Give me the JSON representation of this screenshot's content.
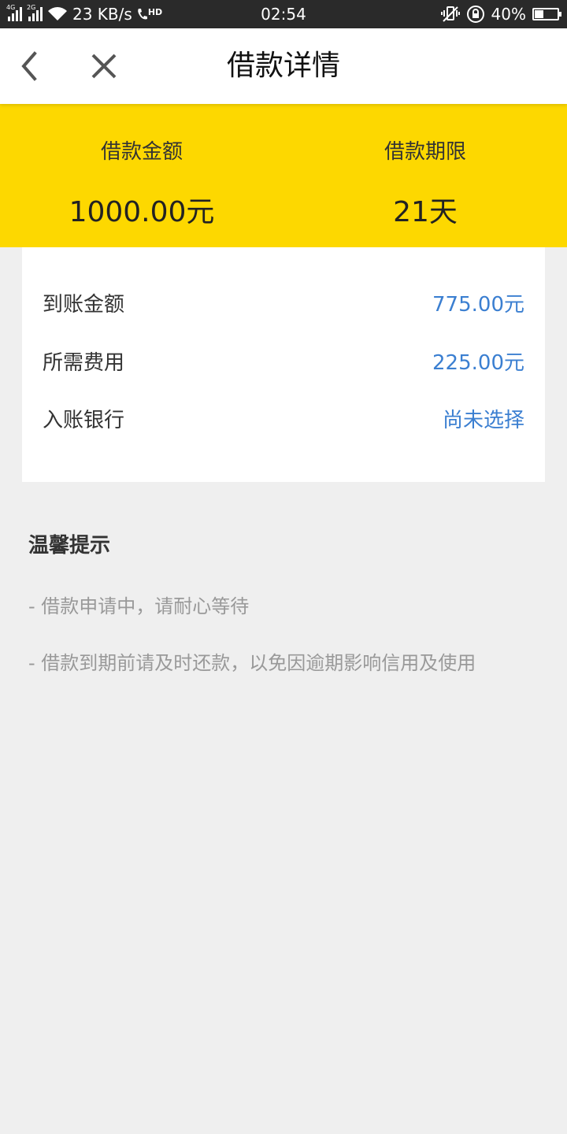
{
  "status_bar": {
    "net1": "4G",
    "net2": "2G",
    "speed": "23 KB/s",
    "hd": "HD",
    "time": "02:54",
    "battery_pct": "40%",
    "battery_level": 0.4
  },
  "nav": {
    "title": "借款详情",
    "back_icon": "chevron-left-icon",
    "close_icon": "close-icon"
  },
  "summary": {
    "amount_label": "借款金额",
    "amount_value": "1000.00元",
    "term_label": "借款期限",
    "term_value": "21天",
    "bg_color": "#fdd800"
  },
  "details": [
    {
      "label": "到账金额",
      "value": "775.00元"
    },
    {
      "label": "所需费用",
      "value": "225.00元"
    },
    {
      "label": "入账银行",
      "value": "尚未选择"
    }
  ],
  "tips": {
    "title": "温馨提示",
    "items": [
      "- 借款申请中，请耐心等待",
      "- 借款到期前请及时还款，以免因逾期影响信用及使用"
    ]
  },
  "colors": {
    "accent": "#3b7fd1",
    "page_bg": "#efefef"
  }
}
